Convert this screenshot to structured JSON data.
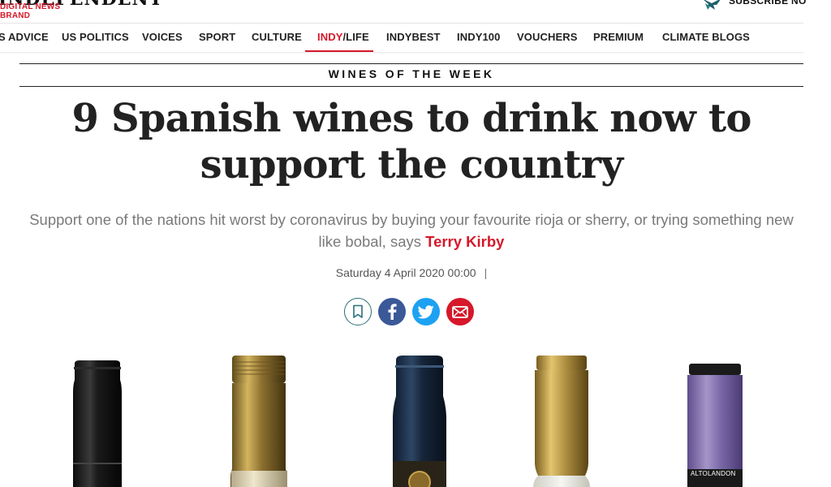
{
  "brand": {
    "logo_text": "INDEPENDENT",
    "tagline": "DIGITAL NEWS BRAND",
    "subscribe_label": "SUBSCRIBE NO"
  },
  "nav": {
    "items": [
      {
        "label": "S ADVICE"
      },
      {
        "label": "US POLITICS"
      },
      {
        "label": "VOICES"
      },
      {
        "label": "SPORT"
      },
      {
        "label": "CULTURE"
      },
      {
        "label_a": "INDY",
        "label_b": "/LIFE",
        "active": true
      },
      {
        "label": "INDYBEST"
      },
      {
        "label": "INDY100"
      },
      {
        "label": "VOUCHERS"
      },
      {
        "label": "PREMIUM"
      },
      {
        "label": "CLIMATE BLOGS"
      }
    ]
  },
  "article": {
    "section": "WINES OF THE WEEK",
    "headline": "9 Spanish wines to drink now to support the country",
    "standfirst_pre": "Support one of the nations hit worst by coronavirus by buying your favourite rioja or sherry, or trying something new like bobal, says ",
    "author": "Terry Kirby",
    "date": "Saturday 4 April 2020 00:00",
    "date_sep": "|"
  },
  "share": {
    "bookmark_icon": "bookmark-icon",
    "facebook_icon": "facebook-icon",
    "twitter_icon": "twitter-icon",
    "email_icon": "email-icon"
  },
  "image": {
    "bottle_label_text": "ALTOLANDON"
  },
  "colors": {
    "accent": "#d6182a",
    "facebook": "#3b5998",
    "twitter": "#1da1f2",
    "email": "#d6182a",
    "bookmark": "#2b6f78"
  }
}
